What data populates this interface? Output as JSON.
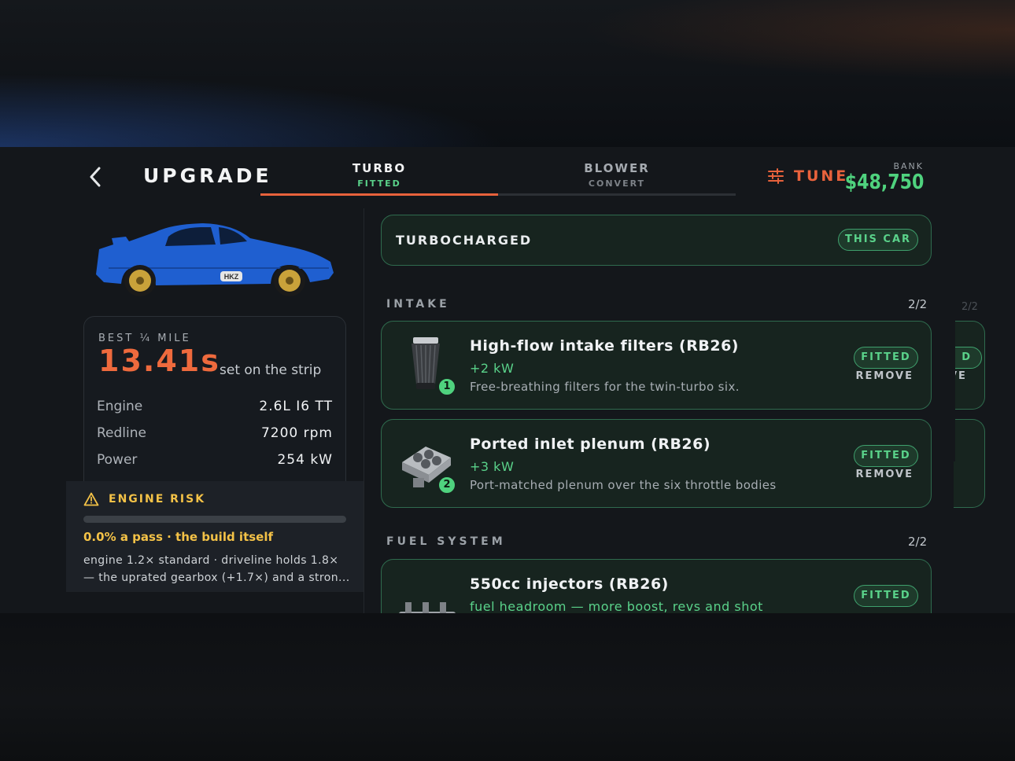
{
  "header": {
    "title": "UPGRADE",
    "tabs": [
      {
        "label": "TURBO",
        "sub": "FITTED"
      },
      {
        "label": "BLOWER",
        "sub": "CONVERT"
      }
    ],
    "tune_label": "TUNE",
    "bank_label": "BANK",
    "bank_value": "$48,750"
  },
  "car": {
    "plate": "HKZ",
    "color": "#1f5fd0"
  },
  "stats": {
    "best_label": "BEST ¼ MILE",
    "best_value": "13.41s",
    "best_note": "set on the strip",
    "rows": [
      {
        "key": "Engine",
        "value": "2.6L I6 TT"
      },
      {
        "key": "Redline",
        "value": "7200 rpm"
      },
      {
        "key": "Power",
        "value": "254 kW"
      }
    ]
  },
  "risk": {
    "title": "ENGINE RISK",
    "level": 0.0,
    "pass_text": "0.0% a pass · the build itself",
    "desc": "engine 1.2× standard · driveline holds 1.8× — the uprated gearbox (+1.7×) and a stron..."
  },
  "banner": {
    "label": "TURBOCHARGED",
    "pill": "THIS CAR"
  },
  "sections": {
    "intake": {
      "label": "INTAKE",
      "count": "2/2"
    },
    "fuel": {
      "label": "FUEL SYSTEM",
      "count": "2/2"
    }
  },
  "parts": [
    {
      "index": "1",
      "name": "High-flow intake filters (RB26)",
      "gain": "+2 kW",
      "desc": "Free-breathing filters for the twin-turbo six.",
      "status": "FITTED",
      "action": "REMOVE"
    },
    {
      "index": "2",
      "name": "Ported inlet plenum (RB26)",
      "gain": "+3 kW",
      "desc": "Port-matched plenum over the six throttle bodies",
      "status": "FITTED",
      "action": "REMOVE"
    },
    {
      "name": "550cc injectors (RB26)",
      "gain": "fuel headroom — more boost, revs and shot",
      "status": "FITTED"
    }
  ],
  "ghost": {
    "count": "2/2",
    "pill": "D",
    "action": "VE"
  },
  "colors": {
    "accent": "#e8623c",
    "money": "#4fd27e",
    "warn": "#f4c247",
    "fitted": "#5ad28a"
  }
}
